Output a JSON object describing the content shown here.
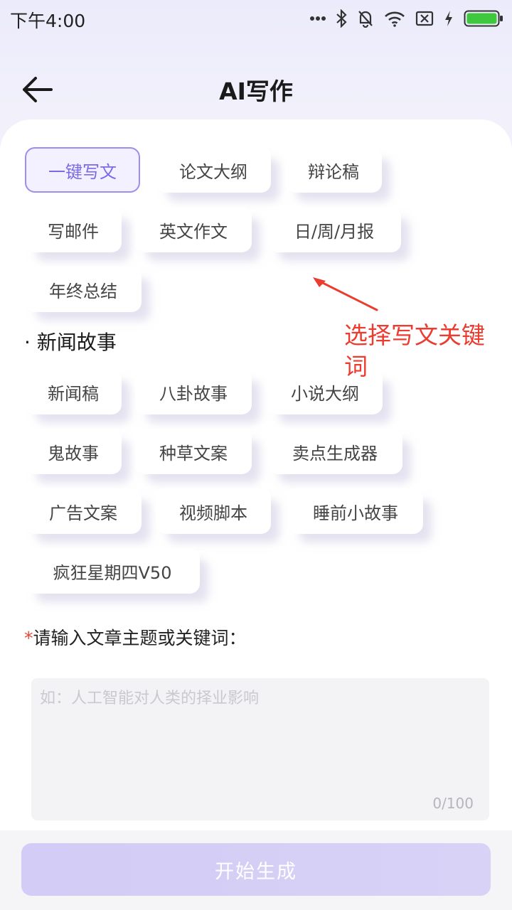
{
  "status_bar": {
    "time": "下午4:00",
    "icons": [
      "more-dots-icon",
      "bluetooth-icon",
      "mute-bell-icon",
      "wifi-icon",
      "no-sim-icon",
      "charging-icon",
      "battery-icon"
    ]
  },
  "header": {
    "title": "AI写作",
    "back_icon": "arrow-left-icon"
  },
  "categories": {
    "group1": [
      "一键写文",
      "论文大纲",
      "辩论稿",
      "写邮件",
      "英文作文",
      "日/周/月报",
      "年终总结"
    ],
    "selected": "一键写文",
    "group2_title": "· 新闻故事",
    "group2": [
      "新闻稿",
      "八卦故事",
      "小说大纲",
      "鬼故事",
      "种草文案",
      "卖点生成器",
      "广告文案",
      "视频脚本",
      "睡前小故事",
      "疯狂星期四V50"
    ]
  },
  "input": {
    "required_mark": "*",
    "label": "请输入文章主题或关键词：",
    "placeholder": "如：人工智能对人类的择业影响",
    "value": "",
    "counter": "0/100"
  },
  "generate_button": {
    "label": "开始生成"
  },
  "annotation": {
    "text": "选择写文关键词",
    "color": "#ec3b2f"
  },
  "colors": {
    "accent": "#9b8eef",
    "accent_text": "#7a6ae6",
    "button_bg": "#d2ccf6",
    "battery": "#3ec83e"
  }
}
